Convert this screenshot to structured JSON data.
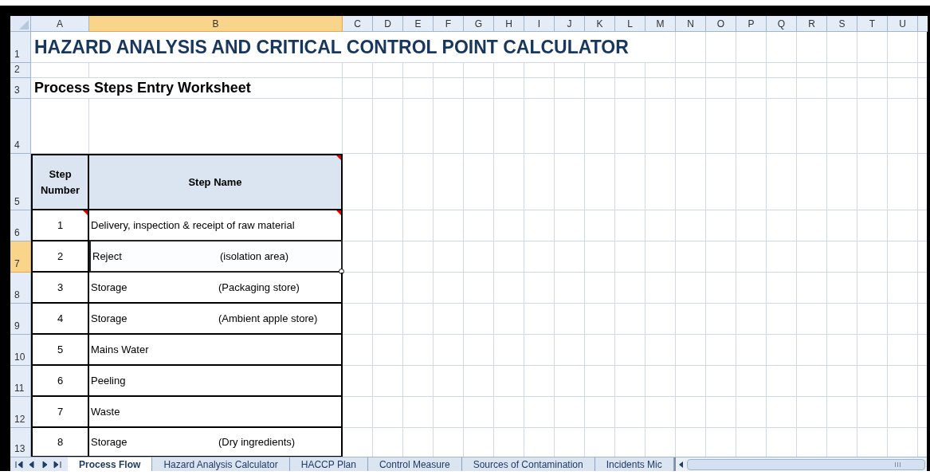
{
  "columns": [
    {
      "label": "A",
      "selected": false
    },
    {
      "label": "B",
      "selected": true
    },
    {
      "label": "C",
      "selected": false
    },
    {
      "label": "D",
      "selected": false
    },
    {
      "label": "E",
      "selected": false
    },
    {
      "label": "F",
      "selected": false
    },
    {
      "label": "G",
      "selected": false
    },
    {
      "label": "H",
      "selected": false
    },
    {
      "label": "I",
      "selected": false
    },
    {
      "label": "J",
      "selected": false
    },
    {
      "label": "K",
      "selected": false
    },
    {
      "label": "L",
      "selected": false
    },
    {
      "label": "M",
      "selected": false
    },
    {
      "label": "N",
      "selected": false
    },
    {
      "label": "O",
      "selected": false
    },
    {
      "label": "P",
      "selected": false
    },
    {
      "label": "Q",
      "selected": false
    },
    {
      "label": "R",
      "selected": false
    },
    {
      "label": "S",
      "selected": false
    },
    {
      "label": "T",
      "selected": false
    },
    {
      "label": "U",
      "selected": false
    }
  ],
  "row_headers": [
    {
      "label": "1",
      "selected": false
    },
    {
      "label": "2",
      "selected": false
    },
    {
      "label": "3",
      "selected": false
    },
    {
      "label": "4",
      "selected": false
    },
    {
      "label": "5",
      "selected": false
    },
    {
      "label": "6",
      "selected": false
    },
    {
      "label": "7",
      "selected": true
    },
    {
      "label": "8",
      "selected": false
    },
    {
      "label": "9",
      "selected": false
    },
    {
      "label": "10",
      "selected": false
    },
    {
      "label": "11",
      "selected": false
    },
    {
      "label": "12",
      "selected": false
    },
    {
      "label": "13",
      "selected": false
    }
  ],
  "title": "HAZARD ANALYSIS AND CRITICAL CONTROL POINT CALCULATOR",
  "subtitle": "Process Steps Entry Worksheet",
  "table": {
    "header": {
      "number_label": "Step Number",
      "name_label": "Step Name",
      "name_comment": true
    },
    "rows": [
      {
        "number": "1",
        "name": "Delivery, inspection & receipt of raw material",
        "number_comment": true,
        "name_comment": true,
        "selected": false
      },
      {
        "number": "2",
        "name": "Reject",
        "note": "(isolation area)",
        "number_comment": false,
        "name_comment": false,
        "selected": true
      },
      {
        "number": "3",
        "name": "Storage",
        "note": "(Packaging store)",
        "number_comment": false,
        "name_comment": false,
        "selected": false
      },
      {
        "number": "4",
        "name": "Storage",
        "note": "(Ambient apple store)",
        "number_comment": false,
        "name_comment": false,
        "selected": false
      },
      {
        "number": "5",
        "name": "Mains Water",
        "number_comment": false,
        "name_comment": false,
        "selected": false
      },
      {
        "number": "6",
        "name": "Peeling",
        "number_comment": false,
        "name_comment": false,
        "selected": false
      },
      {
        "number": "7",
        "name": "Waste",
        "number_comment": false,
        "name_comment": false,
        "selected": false
      },
      {
        "number": "8",
        "name": "Storage",
        "note": "(Dry ingredients)",
        "number_comment": false,
        "name_comment": false,
        "selected": false
      }
    ]
  },
  "sheet_tabs": [
    {
      "label": "Process Flow",
      "selected": true
    },
    {
      "label": "Hazard Analysis Calculator",
      "selected": false
    },
    {
      "label": "HACCP Plan",
      "selected": false
    },
    {
      "label": "Control Measure",
      "selected": false
    },
    {
      "label": "Sources of Contamination",
      "selected": false
    },
    {
      "label": "Incidents Mic",
      "selected": false
    }
  ]
}
